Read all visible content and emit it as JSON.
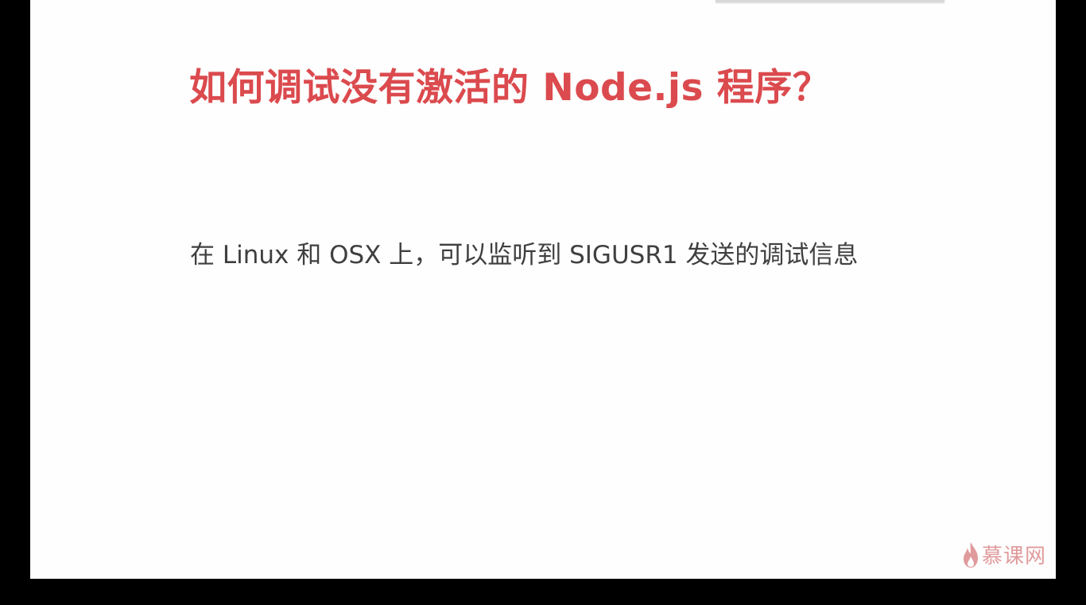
{
  "slide": {
    "title": "如何调试没有激活的 Node.js 程序？",
    "body": "在 Linux 和 OSX 上，可以监听到 SIGUSR1 发送的调试信息"
  },
  "watermark": {
    "text": "慕课网",
    "icon": "flame-icon"
  },
  "colors": {
    "title": "#db4a4e",
    "body_text": "#3f3f3f",
    "slide_background": "#fefefe",
    "letterbox": "#000000",
    "watermark": "#c9494c"
  }
}
